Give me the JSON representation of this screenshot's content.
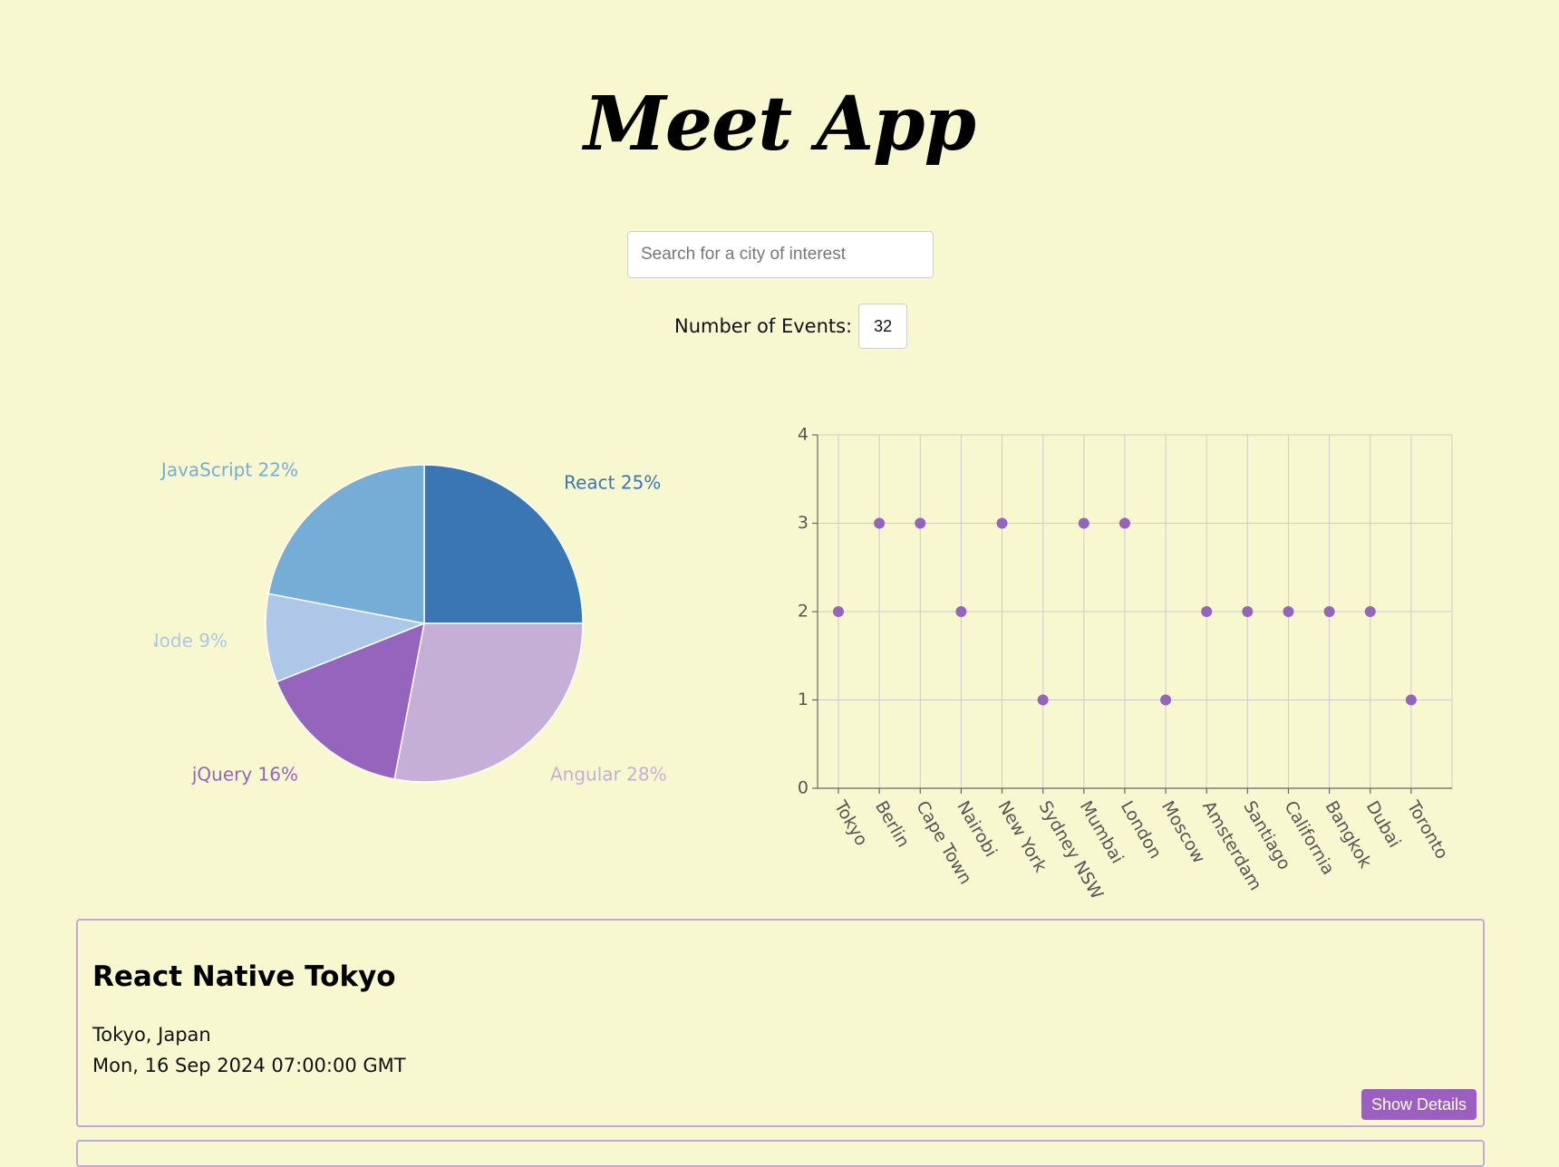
{
  "app": {
    "title": "Meet App"
  },
  "search": {
    "placeholder": "Search for a city of interest",
    "value": ""
  },
  "number_of_events": {
    "label": "Number of Events:",
    "value": "32"
  },
  "chart_data": [
    {
      "type": "pie",
      "title": "",
      "slices": [
        {
          "label": "React",
          "value": 25,
          "color": "#3a76b4"
        },
        {
          "label": "Angular",
          "value": 28,
          "color": "#c5afd6"
        },
        {
          "label": "jQuery",
          "value": 16,
          "color": "#9564bd"
        },
        {
          "label": "Node",
          "value": 9,
          "color": "#aec6e8"
        },
        {
          "label": "JavaScript",
          "value": 22,
          "color": "#76add6"
        }
      ]
    },
    {
      "type": "scatter",
      "title": "",
      "xlabel": "",
      "ylabel": "",
      "categories": [
        "Tokyo",
        "Berlin",
        "Cape Town",
        "Nairobi",
        "New York",
        "Sydney NSW",
        "Mumbai",
        "London",
        "Moscow",
        "Amsterdam",
        "Santiago",
        "California",
        "Bangkok",
        "Dubai",
        "Toronto"
      ],
      "values": [
        2,
        3,
        3,
        2,
        3,
        1,
        3,
        3,
        1,
        2,
        2,
        2,
        2,
        2,
        1
      ],
      "ylim": [
        0,
        4
      ],
      "yticks": [
        0,
        1,
        2,
        3,
        4
      ],
      "grid": true,
      "point_color": "#9564bd"
    }
  ],
  "events": [
    {
      "title": "React Native Tokyo",
      "location": "Tokyo, Japan",
      "datetime": "Mon, 16 Sep 2024 07:00:00 GMT",
      "button_label": "Show Details"
    }
  ]
}
